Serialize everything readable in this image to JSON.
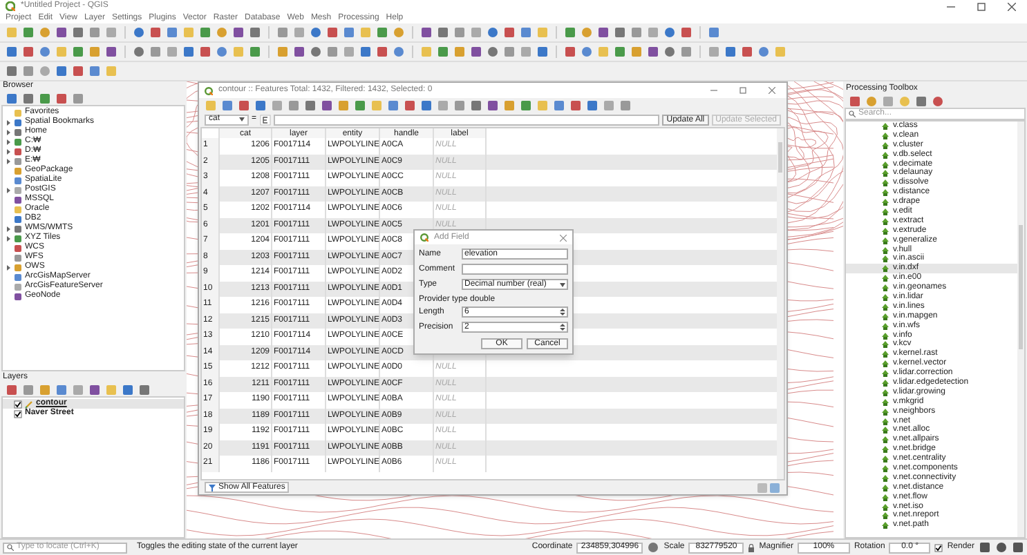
{
  "window": {
    "title": "*Untitled Project - QGIS"
  },
  "menu": [
    "Project",
    "Edit",
    "View",
    "Layer",
    "Settings",
    "Plugins",
    "Vector",
    "Raster",
    "Database",
    "Web",
    "Mesh",
    "Processing",
    "Help"
  ],
  "browser": {
    "title": "Browser",
    "items": [
      {
        "label": "Favorites",
        "expandable": false
      },
      {
        "label": "Spatial Bookmarks",
        "expandable": true
      },
      {
        "label": "Home",
        "expandable": true
      },
      {
        "label": "C:₩",
        "expandable": true
      },
      {
        "label": "D:₩",
        "expandable": true
      },
      {
        "label": "E:₩",
        "expandable": true
      },
      {
        "label": "GeoPackage",
        "expandable": false
      },
      {
        "label": "SpatiaLite",
        "expandable": false
      },
      {
        "label": "PostGIS",
        "expandable": true
      },
      {
        "label": "MSSQL",
        "expandable": false
      },
      {
        "label": "Oracle",
        "expandable": false
      },
      {
        "label": "DB2",
        "expandable": false
      },
      {
        "label": "WMS/WMTS",
        "expandable": true
      },
      {
        "label": "XYZ Tiles",
        "expandable": true
      },
      {
        "label": "WCS",
        "expandable": false
      },
      {
        "label": "WFS",
        "expandable": false
      },
      {
        "label": "OWS",
        "expandable": true
      },
      {
        "label": "ArcGisMapServer",
        "expandable": false
      },
      {
        "label": "ArcGisFeatureServer",
        "expandable": false
      },
      {
        "label": "GeoNode",
        "expandable": false
      }
    ]
  },
  "layers": {
    "title": "Layers",
    "items": [
      {
        "name": "contour",
        "checked": true,
        "selected": true,
        "editing": true
      },
      {
        "name": "Naver Street",
        "checked": true,
        "selected": false,
        "editing": false
      }
    ]
  },
  "attribute_table": {
    "title": "contour :: Features Total: 1432, Filtered: 1432, Selected: 0",
    "field": "cat",
    "operator": "=",
    "update_all": "Update All",
    "update_selected": {
      "label": "Update Selected",
      "disabled": true
    },
    "columns": [
      "cat",
      "layer",
      "entity",
      "handle",
      "label"
    ],
    "rows": [
      {
        "number": "1",
        "cells": [
          "1206",
          "F0017114",
          "LWPOLYLINE",
          "A0CA",
          "NULL"
        ]
      },
      {
        "number": "2",
        "cells": [
          "1205",
          "F0017111",
          "LWPOLYLINE",
          "A0C9",
          "NULL"
        ]
      },
      {
        "number": "3",
        "cells": [
          "1208",
          "F0017111",
          "LWPOLYLINE",
          "A0CC",
          "NULL"
        ]
      },
      {
        "number": "4",
        "cells": [
          "1207",
          "F0017111",
          "LWPOLYLINE",
          "A0CB",
          "NULL"
        ]
      },
      {
        "number": "5",
        "cells": [
          "1202",
          "F0017114",
          "LWPOLYLINE",
          "A0C6",
          "NULL"
        ]
      },
      {
        "number": "6",
        "cells": [
          "1201",
          "F0017111",
          "LWPOLYLINE",
          "A0C5",
          "NULL"
        ]
      },
      {
        "number": "7",
        "cells": [
          "1204",
          "F0017111",
          "LWPOLYLINE",
          "A0C8"
        ]
      },
      {
        "number": "8",
        "cells": [
          "1203",
          "F0017111",
          "LWPOLYLINE",
          "A0C7"
        ]
      },
      {
        "number": "9",
        "cells": [
          "1214",
          "F0017111",
          "LWPOLYLINE",
          "A0D2"
        ]
      },
      {
        "number": "10",
        "cells": [
          "1213",
          "F0017111",
          "LWPOLYLINE",
          "A0D1"
        ]
      },
      {
        "number": "11",
        "cells": [
          "1216",
          "F0017111",
          "LWPOLYLINE",
          "A0D4"
        ]
      },
      {
        "number": "12",
        "cells": [
          "1215",
          "F0017111",
          "LWPOLYLINE",
          "A0D3"
        ]
      },
      {
        "number": "13",
        "cells": [
          "1210",
          "F0017114",
          "LWPOLYLINE",
          "A0CE"
        ]
      },
      {
        "number": "14",
        "cells": [
          "1209",
          "F0017114",
          "LWPOLYLINE",
          "A0CD"
        ]
      },
      {
        "number": "15",
        "cells": [
          "1212",
          "F0017111",
          "LWPOLYLINE",
          "A0D0",
          "NULL"
        ]
      },
      {
        "number": "16",
        "cells": [
          "1211",
          "F0017111",
          "LWPOLYLINE",
          "A0CF",
          "NULL"
        ]
      },
      {
        "number": "17",
        "cells": [
          "1190",
          "F0017111",
          "LWPOLYLINE",
          "A0BA",
          "NULL"
        ]
      },
      {
        "number": "18",
        "cells": [
          "1189",
          "F0017111",
          "LWPOLYLINE",
          "A0B9",
          "NULL"
        ]
      },
      {
        "number": "19",
        "cells": [
          "1192",
          "F0017111",
          "LWPOLYLINE",
          "A0BC",
          "NULL"
        ]
      },
      {
        "number": "20",
        "cells": [
          "1191",
          "F0017111",
          "LWPOLYLINE",
          "A0BB",
          "NULL"
        ]
      },
      {
        "number": "21",
        "cells": [
          "1186",
          "F0017111",
          "LWPOLYLINE",
          "A0B6",
          "NULL"
        ]
      }
    ],
    "show_all": "Show All Features"
  },
  "add_field_dialog": {
    "title": "Add Field",
    "name_label": "Name",
    "name_value": "elevation",
    "comment_label": "Comment",
    "type_label": "Type",
    "type_value": "Decimal number (real)",
    "provider_type": "Provider type  double",
    "length_label": "Length",
    "length_value": "6",
    "precision_label": "Precision",
    "precision_value": "2",
    "buttons": [
      "OK",
      "Cancel"
    ]
  },
  "processing_toolbox": {
    "title": "Processing Toolbox",
    "search_placeholder": "Search...",
    "items": [
      {
        "label": "v.class",
        "selected": false
      },
      {
        "label": "v.clean",
        "selected": false
      },
      {
        "label": "v.cluster",
        "selected": false
      },
      {
        "label": "v.db.select",
        "selected": false
      },
      {
        "label": "v.decimate",
        "selected": false
      },
      {
        "label": "v.delaunay",
        "selected": false
      },
      {
        "label": "v.dissolve",
        "selected": false
      },
      {
        "label": "v.distance",
        "selected": false
      },
      {
        "label": "v.drape",
        "selected": false
      },
      {
        "label": "v.edit",
        "selected": false
      },
      {
        "label": "v.extract",
        "selected": false
      },
      {
        "label": "v.extrude",
        "selected": false
      },
      {
        "label": "v.generalize",
        "selected": false
      },
      {
        "label": "v.hull",
        "selected": false
      },
      {
        "label": "v.in.ascii",
        "selected": false
      },
      {
        "label": "v.in.dxf",
        "selected": true
      },
      {
        "label": "v.in.e00",
        "selected": false
      },
      {
        "label": "v.in.geonames",
        "selected": false
      },
      {
        "label": "v.in.lidar",
        "selected": false
      },
      {
        "label": "v.in.lines",
        "selected": false
      },
      {
        "label": "v.in.mapgen",
        "selected": false
      },
      {
        "label": "v.in.wfs",
        "selected": false
      },
      {
        "label": "v.info",
        "selected": false
      },
      {
        "label": "v.kcv",
        "selected": false
      },
      {
        "label": "v.kernel.rast",
        "selected": false
      },
      {
        "label": "v.kernel.vector",
        "selected": false
      },
      {
        "label": "v.lidar.correction",
        "selected": false
      },
      {
        "label": "v.lidar.edgedetection",
        "selected": false
      },
      {
        "label": "v.lidar.growing",
        "selected": false
      },
      {
        "label": "v.mkgrid",
        "selected": false
      },
      {
        "label": "v.neighbors",
        "selected": false
      },
      {
        "label": "v.net",
        "selected": false
      },
      {
        "label": "v.net.alloc",
        "selected": false
      },
      {
        "label": "v.net.allpairs",
        "selected": false
      },
      {
        "label": "v.net.bridge",
        "selected": false
      },
      {
        "label": "v.net.centrality",
        "selected": false
      },
      {
        "label": "v.net.components",
        "selected": false
      },
      {
        "label": "v.net.connectivity",
        "selected": false
      },
      {
        "label": "v.net.distance",
        "selected": false
      },
      {
        "label": "v.net.flow",
        "selected": false
      },
      {
        "label": "v.net.iso",
        "selected": false
      },
      {
        "label": "v.net.nreport",
        "selected": false
      },
      {
        "label": "v.net.path",
        "selected": false
      }
    ]
  },
  "status_bar": {
    "locate_placeholder": "Type to locate (Ctrl+K)",
    "message": "Toggles the editing state of the current layer",
    "coordinate_label": "Coordinate",
    "coordinate_value": "234859,304996",
    "scale_label": "Scale",
    "scale_value": "832779520",
    "magnifier_label": "Magnifier",
    "magnifier_value": "100%",
    "rotation_label": "Rotation",
    "rotation_value": "0.0 °",
    "render": {
      "label": "Render",
      "checked": true
    }
  }
}
